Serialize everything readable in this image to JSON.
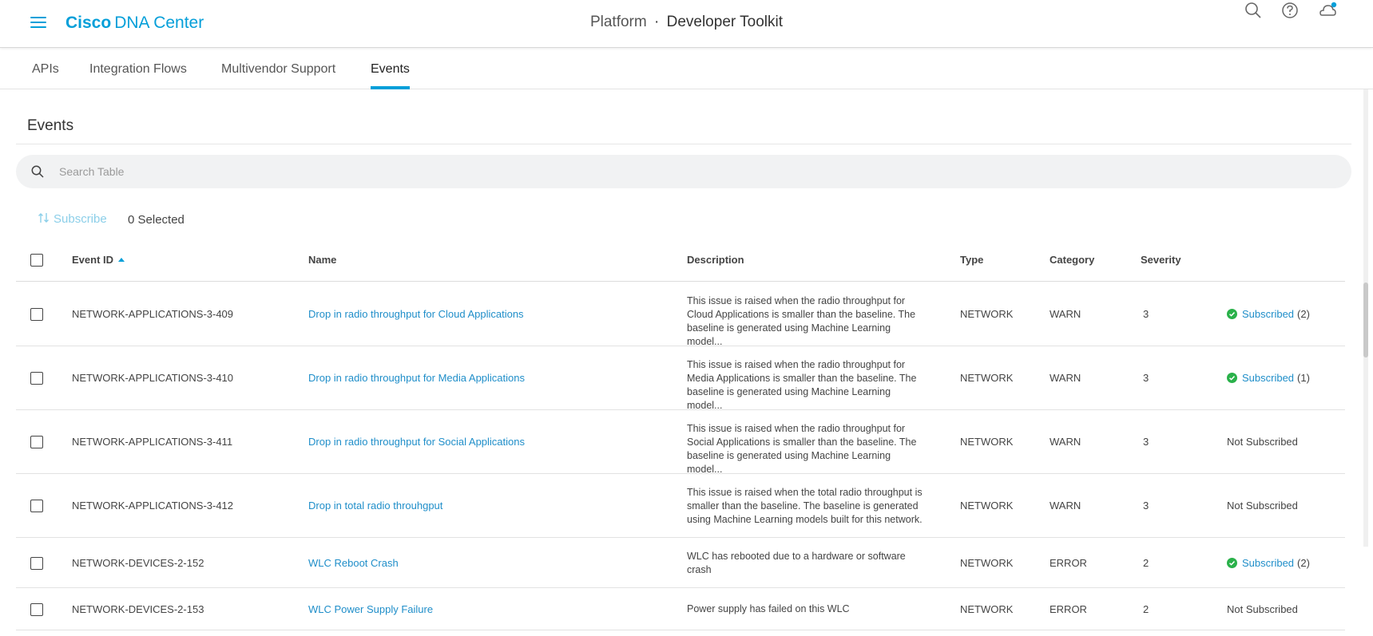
{
  "header": {
    "brand_bold": "Cisco",
    "brand_rest": "DNA Center",
    "title_left": "Platform",
    "title_sep": "·",
    "title_right": "Developer Toolkit",
    "icons": [
      "search-icon",
      "help-icon",
      "notifications-icon"
    ]
  },
  "tabs": [
    {
      "label": "APIs",
      "active": false
    },
    {
      "label": "Integration Flows",
      "active": false
    },
    {
      "label": "Multivendor Support",
      "active": false
    },
    {
      "label": "Events",
      "active": true
    }
  ],
  "section": {
    "title": "Events"
  },
  "search": {
    "placeholder": "Search Table",
    "value": ""
  },
  "toolbar": {
    "subscribe_label": "Subscribe",
    "selected_label": "0 Selected"
  },
  "table": {
    "columns": [
      "Event ID",
      "Name",
      "Description",
      "Type",
      "Category",
      "Severity"
    ],
    "sort_column": "Event ID",
    "sort_direction": "ascending",
    "rows": [
      {
        "event_id": "NETWORK-APPLICATIONS-3-409",
        "name": "Drop in radio throughput for Cloud Applications",
        "description_lines": [
          "This issue is raised when the radio throughput for",
          "Cloud Applications is smaller than the baseline. The",
          "baseline is generated using Machine Learning model..."
        ],
        "type": "NETWORK",
        "category": "WARN",
        "severity": "3",
        "status": "Subscribed",
        "subscribed": true,
        "count": "(2)"
      },
      {
        "event_id": "NETWORK-APPLICATIONS-3-410",
        "name": "Drop in radio throughput for Media Applications",
        "description_lines": [
          "This issue is raised when the radio throughput for",
          "Media Applications is smaller than the baseline. The",
          "baseline is generated using Machine Learning model..."
        ],
        "type": "NETWORK",
        "category": "WARN",
        "severity": "3",
        "status": "Subscribed",
        "subscribed": true,
        "count": "(1)"
      },
      {
        "event_id": "NETWORK-APPLICATIONS-3-411",
        "name": "Drop in radio throughput for Social Applications",
        "description_lines": [
          "This issue is raised when the radio throughput for",
          "Social Applications is smaller than the baseline. The",
          "baseline is generated using Machine Learning model..."
        ],
        "type": "NETWORK",
        "category": "WARN",
        "severity": "3",
        "status": "Not Subscribed",
        "subscribed": false,
        "count": ""
      },
      {
        "event_id": "NETWORK-APPLICATIONS-3-412",
        "name": "Drop in total radio throuhgput",
        "description_lines": [
          "This issue is raised when the total radio throughput is",
          "smaller than the baseline. The baseline is generated",
          "using Machine Learning models built for this network."
        ],
        "type": "NETWORK",
        "category": "WARN",
        "severity": "3",
        "status": "Not Subscribed",
        "subscribed": false,
        "count": ""
      },
      {
        "event_id": "NETWORK-DEVICES-2-152",
        "name": "WLC Reboot Crash",
        "description_lines": [
          "WLC has rebooted due to a hardware or software",
          "crash"
        ],
        "type": "NETWORK",
        "category": "ERROR",
        "severity": "2",
        "status": "Subscribed",
        "subscribed": true,
        "count": "(2)"
      },
      {
        "event_id": "NETWORK-DEVICES-2-153",
        "name": "WLC Power Supply Failure",
        "description_lines": [
          "Power supply has failed on this WLC"
        ],
        "type": "NETWORK",
        "category": "ERROR",
        "severity": "2",
        "status": "Not Subscribed",
        "subscribed": false,
        "count": ""
      }
    ]
  },
  "colors": {
    "accent": "#049fd9",
    "link": "#1f8ec9",
    "success": "#2ab14a"
  }
}
